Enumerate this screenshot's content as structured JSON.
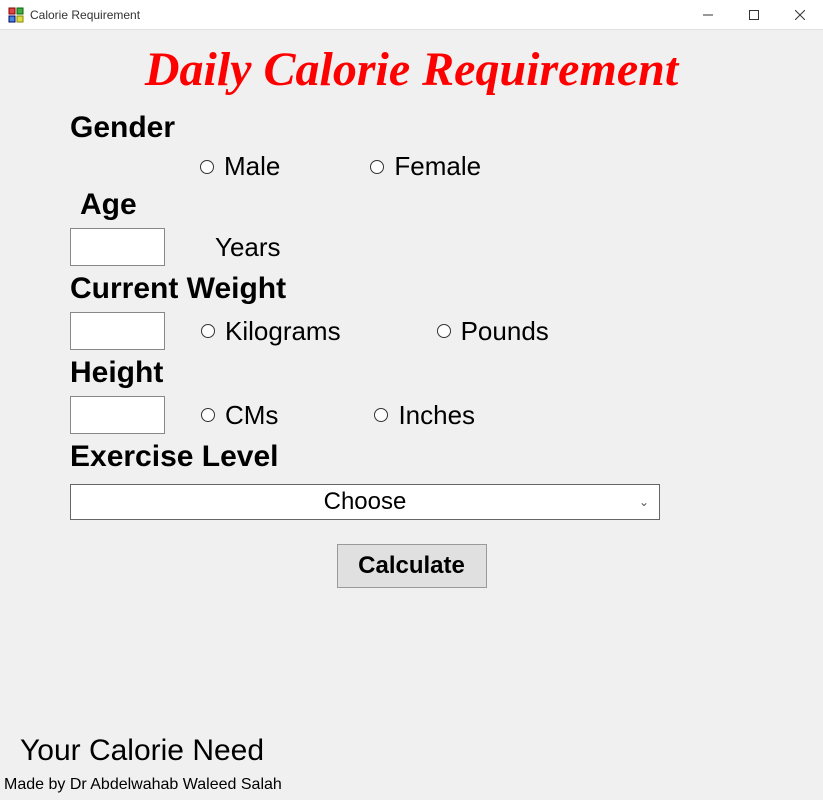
{
  "window": {
    "title": "Calorie Requirement"
  },
  "header": {
    "title": "Daily Calorie Requirement"
  },
  "gender": {
    "label": "Gender",
    "option_male": "Male",
    "option_female": "Female"
  },
  "age": {
    "label": "Age",
    "value": "",
    "unit": "Years"
  },
  "weight": {
    "label": "Current Weight",
    "value": "",
    "option_kg": "Kilograms",
    "option_lb": "Pounds"
  },
  "height": {
    "label": "Height",
    "value": "",
    "option_cm": "CMs",
    "option_in": "Inches"
  },
  "exercise": {
    "label": "Exercise Level",
    "selected": "Choose"
  },
  "actions": {
    "calculate": "Calculate"
  },
  "result": {
    "label": "Your Calorie Need"
  },
  "footer": {
    "credit": "Made by Dr Abdelwahab Waleed Salah"
  }
}
